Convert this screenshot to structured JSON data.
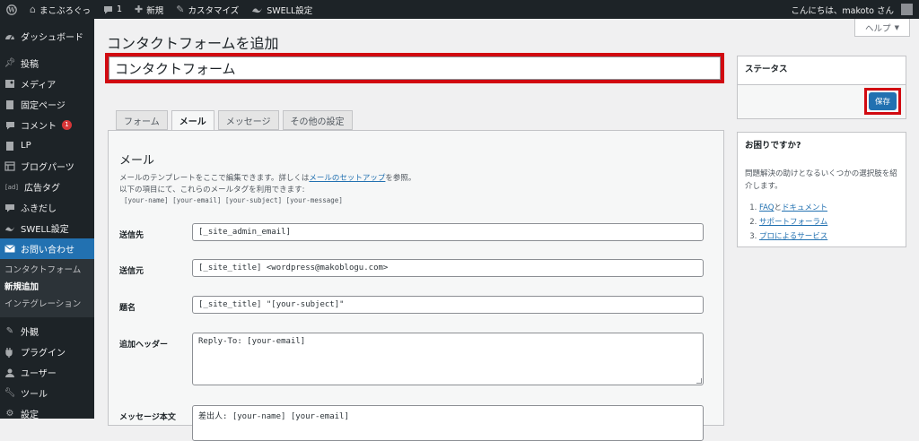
{
  "adminbar": {
    "site_name": "まこぶろぐっ",
    "comments_count": "1",
    "new_label": "新規",
    "customize_label": "カスタマイズ",
    "swell_label": "SWELL設定",
    "greeting": "こんにちは、makoto さん"
  },
  "sidebar": {
    "items": [
      {
        "label": "ダッシュボード",
        "icon": "dashboard-icon"
      },
      {
        "label": "投稿",
        "icon": "pin-icon"
      },
      {
        "label": "メディア",
        "icon": "media-icon"
      },
      {
        "label": "固定ページ",
        "icon": "page-icon"
      },
      {
        "label": "コメント",
        "icon": "comment-icon",
        "badge": "1"
      },
      {
        "label": "LP",
        "icon": "lp-icon"
      },
      {
        "label": "ブログパーツ",
        "icon": "blocks-icon"
      },
      {
        "label": "広告タグ",
        "icon": "ad-icon",
        "icon_text": "[ad]"
      },
      {
        "label": "ふきだし",
        "icon": "balloon-icon"
      },
      {
        "label": "SWELL設定",
        "icon": "swell-icon"
      },
      {
        "label": "お問い合わせ",
        "icon": "mail-icon"
      }
    ],
    "submenu": [
      "コンタクトフォーム",
      "新規追加",
      "インテグレーション"
    ],
    "bottom_items": [
      {
        "label": "外観",
        "icon": "brush-icon"
      },
      {
        "label": "プラグイン",
        "icon": "plugin-icon"
      },
      {
        "label": "ユーザー",
        "icon": "user-icon"
      },
      {
        "label": "ツール",
        "icon": "wrench-icon"
      },
      {
        "label": "設定",
        "icon": "settings-icon"
      }
    ]
  },
  "help_tab": {
    "label": "ヘルプ",
    "arrow": "▼"
  },
  "page": {
    "title": "コンタクトフォームを追加",
    "form_title_value": "コンタクトフォーム"
  },
  "tabs": [
    "フォーム",
    "メール",
    "メッセージ",
    "その他の設定"
  ],
  "mail_panel": {
    "heading": "メール",
    "desc1_pre": "メールのテンプレートをここで編集できます。詳しくは",
    "desc1_link": "メールのセットアップ",
    "desc1_post": "を参照。",
    "desc2": "以下の項目にて、これらのメールタグを利用できます:",
    "tags": "[your-name] [your-email] [your-subject] [your-message]",
    "fields": [
      {
        "label": "送信先",
        "value": "[_site_admin_email]"
      },
      {
        "label": "送信元",
        "value": "[_site_title] <wordpress@makoblogu.com>"
      },
      {
        "label": "題名",
        "value": "[_site_title] \"[your-subject]\""
      },
      {
        "label": "追加ヘッダー",
        "value": "Reply-To: [your-email]"
      },
      {
        "label": "メッセージ本文",
        "value": "差出人: [your-name] [your-email]"
      }
    ]
  },
  "status_box": {
    "title": "ステータス",
    "save_label": "保存"
  },
  "help_box": {
    "title": "お困りですか?",
    "text": "問題解決の助けとなるいくつかの選択肢を紹介します。",
    "links": [
      {
        "a": "FAQ",
        "mid": "と",
        "b": "ドキュメント"
      },
      {
        "a": "サポートフォーラム"
      },
      {
        "a": "プロによるサービス"
      }
    ]
  },
  "colors": {
    "accent": "#2271b1",
    "highlight_frame": "#d10a11",
    "adminbar": "#1d2327"
  }
}
